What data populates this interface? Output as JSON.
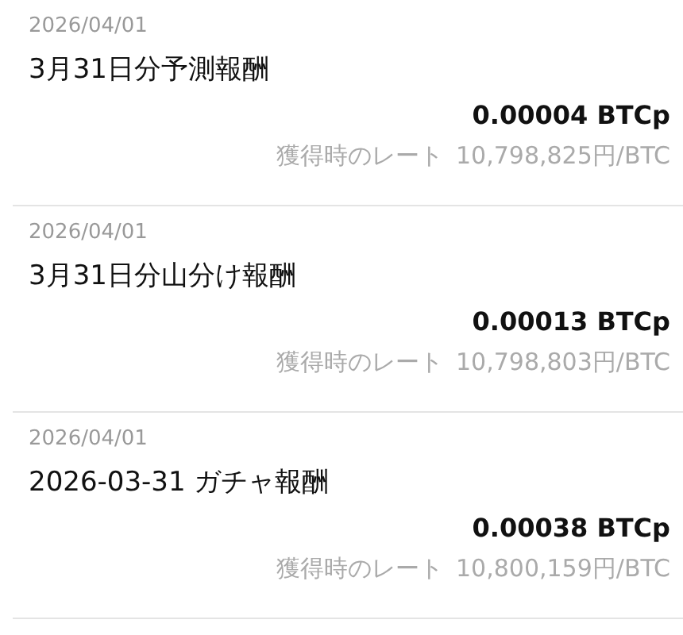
{
  "rewards": [
    {
      "date": "2026/04/01",
      "title": "3月31日分予測報酬",
      "amount": "0.00004 BTCp",
      "rate_label": "獲得時のレート",
      "rate": "10,798,825円/BTC"
    },
    {
      "date": "2026/04/01",
      "title": "3月31日分山分け報酬",
      "amount": "0.00013 BTCp",
      "rate_label": "獲得時のレート",
      "rate": "10,798,803円/BTC"
    },
    {
      "date": "2026/04/01",
      "title": "2026-03-31 ガチャ報酬",
      "amount": "0.00038 BTCp",
      "rate_label": "獲得時のレート",
      "rate": "10,800,159円/BTC"
    }
  ]
}
